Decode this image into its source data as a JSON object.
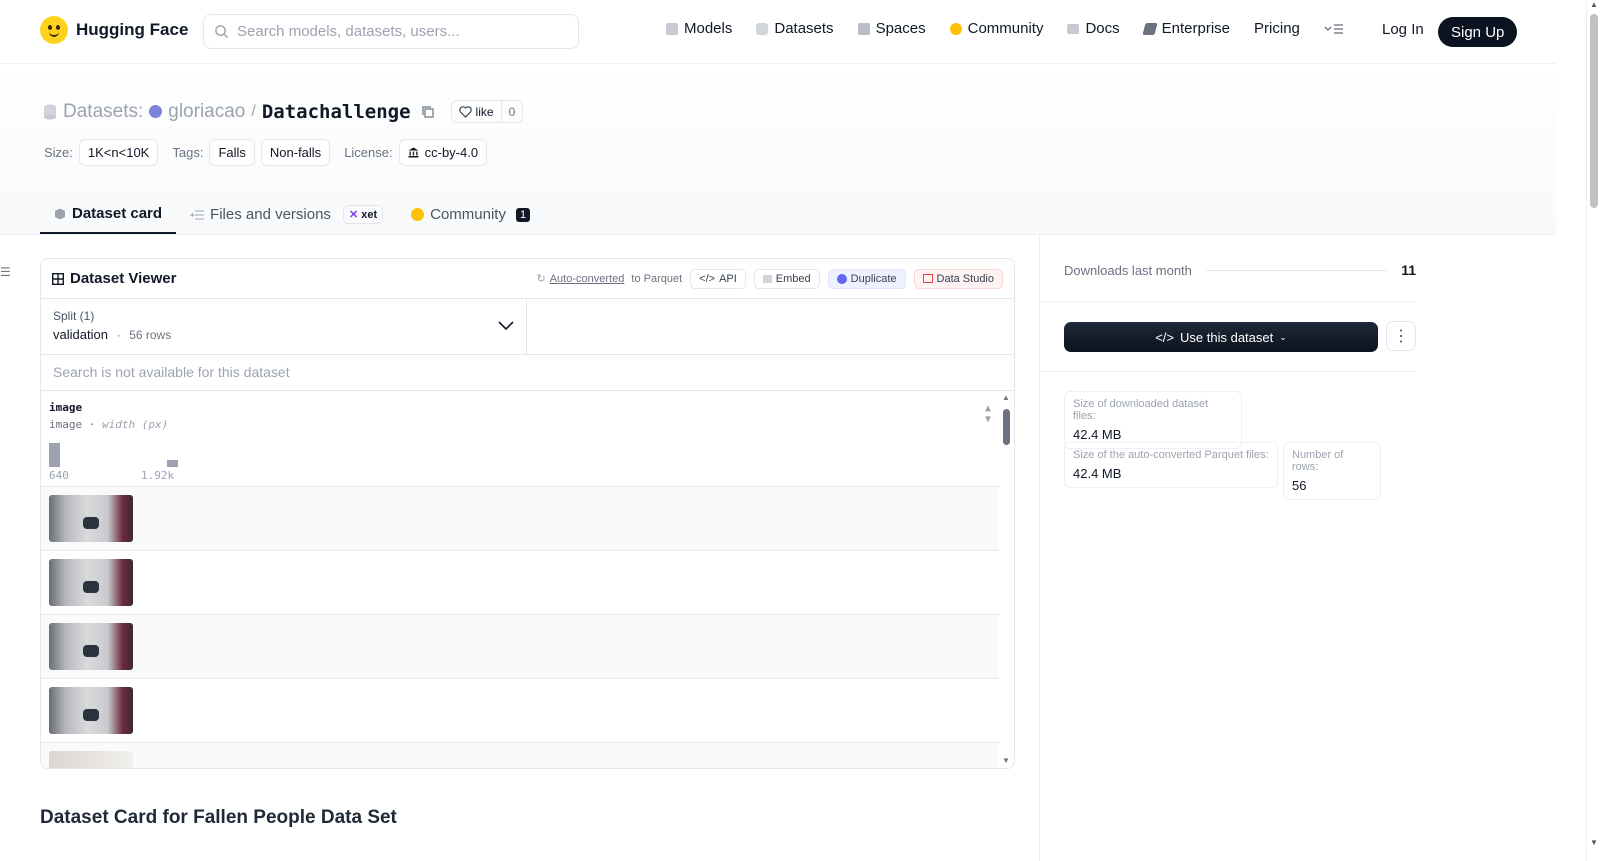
{
  "topbar": {
    "brand": "Hugging Face",
    "search_placeholder": "Search models, datasets, users...",
    "nav": [
      {
        "label": "Models",
        "color": "#c7cad1"
      },
      {
        "label": "Datasets",
        "color": "#d1d5db"
      },
      {
        "label": "Spaces",
        "color": "#b9bec8"
      },
      {
        "label": "Community",
        "color": "#ffc107"
      },
      {
        "label": "Docs",
        "color": "#c7cad1"
      },
      {
        "label": "Enterprise",
        "color": "#6b7280"
      },
      {
        "label": "Pricing",
        "color": ""
      }
    ],
    "login": "Log In",
    "signup": "Sign Up"
  },
  "header": {
    "section": "Datasets:",
    "owner": "gloriacao",
    "slash": "/",
    "name": "Datachallenge",
    "like_label": "like",
    "like_count": "0",
    "size_label": "Size:",
    "size_value": "1K<n<10K",
    "tags_label": "Tags:",
    "tags": [
      "Falls",
      "Non-falls"
    ],
    "license_label": "License:",
    "license_value": "cc-by-4.0"
  },
  "tabs": {
    "card": "Dataset card",
    "files": "Files and versions",
    "xet": "xet",
    "community": "Community",
    "community_count": "1"
  },
  "viewer": {
    "title": "Dataset Viewer",
    "auto_converted": "Auto-converted",
    "to_parquet": " to Parquet",
    "api": "API",
    "embed": "Embed",
    "duplicate": "Duplicate",
    "data_studio": "Data Studio",
    "split_label": "Split (1)",
    "split_value": "validation",
    "split_dot": "·",
    "split_rows": "56 rows",
    "search_na": "Search is not available for this dataset",
    "column": {
      "name": "image",
      "type": "image",
      "type_sep": " · ",
      "stat": "width (px)",
      "min": "640",
      "max": "1.92k"
    }
  },
  "card_title": "Dataset Card for Fallen People Data Set",
  "sidebar": {
    "downloads_label": "Downloads last month",
    "downloads_value": "11",
    "use_btn": "Use this dataset",
    "size_dl_label": "Size of downloaded dataset files:",
    "size_dl_value": "42.4 MB",
    "size_parquet_label": "Size of the auto-converted Parquet files:",
    "size_parquet_value": "42.4 MB",
    "rows_label": "Number of rows:",
    "rows_value": "56"
  }
}
